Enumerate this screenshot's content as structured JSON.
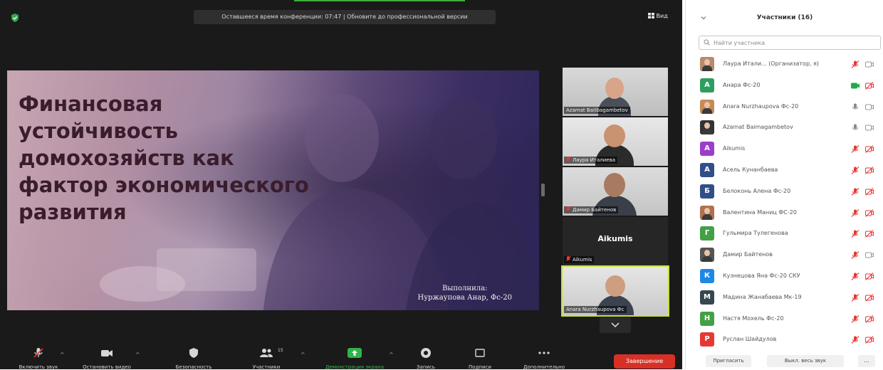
{
  "topbar": {
    "notice": "Оставшееся время конференции: 07:47 | Обновите до профессиональной версии",
    "view_label": "Вид"
  },
  "slide": {
    "title_lines": [
      "Финансовая",
      "устойчивость",
      "домохозяйств как",
      "фактор экономического",
      "развития"
    ],
    "author_lines": [
      "Выполнила:",
      "Нуржаупова Анар, Фс-20"
    ]
  },
  "video_tiles": [
    {
      "name": "Azamat Baitbagambetov",
      "muted": false
    },
    {
      "name": "Лаура Италиева",
      "muted": true
    },
    {
      "name": "Дамир Байтенов",
      "muted": true
    },
    {
      "name": "Aikumis",
      "muted": true,
      "name_card": "Aikumis"
    },
    {
      "name": "Anara Nurzhaupova Фс",
      "muted": false,
      "active": true
    }
  ],
  "toolbar": {
    "items": [
      {
        "label": "Включить звук",
        "icon": "mic-muted-icon"
      },
      {
        "label": "Остановить видео",
        "icon": "video-camera-icon"
      },
      {
        "label": "Безопасность",
        "icon": "shield-icon"
      },
      {
        "label": "Участники",
        "icon": "participants-icon",
        "count": "15"
      },
      {
        "label": "Демонстрация экрана",
        "icon": "share-screen-icon"
      },
      {
        "label": "Запись",
        "icon": "record-icon"
      },
      {
        "label": "Подписи",
        "icon": "captions-icon"
      },
      {
        "label": "Дополнительно",
        "icon": "more-icon"
      }
    ],
    "end_label": "Завершение"
  },
  "panel": {
    "title": "Участники (16)",
    "search_placeholder": "Найти участника",
    "participants": [
      {
        "name": "Лаура Итали... (Организатор, я)",
        "avatar": "photo",
        "color": "#b98a6a",
        "mic": "muted",
        "cam": "off"
      },
      {
        "name": "Анара Фс-20",
        "avatar": "А",
        "color": "#2e9e5e",
        "mic": "active-video",
        "cam": "muted"
      },
      {
        "name": "Anara Nurzhaupova Фс-20",
        "avatar": "photo",
        "color": "#c58a55",
        "mic": "on",
        "cam": "off"
      },
      {
        "name": "Azamat Baimagambetov",
        "avatar": "photo",
        "color": "#333333",
        "mic": "on",
        "cam": "off"
      },
      {
        "name": "Aikumis",
        "avatar": "A",
        "color": "#9b3fc8",
        "mic": "muted",
        "cam": "muted"
      },
      {
        "name": "Асель Кунанбаева",
        "avatar": "А",
        "color": "#2f4f8a",
        "mic": "muted",
        "cam": "muted"
      },
      {
        "name": "Белоконь Алена Фс-20",
        "avatar": "Б",
        "color": "#2f4f8a",
        "mic": "muted",
        "cam": "muted"
      },
      {
        "name": "Валентина Маниц ФС-20",
        "avatar": "photo",
        "color": "#b07050",
        "mic": "muted",
        "cam": "muted"
      },
      {
        "name": "Гульмира Тулегенова",
        "avatar": "Г",
        "color": "#43a047",
        "mic": "muted",
        "cam": "muted"
      },
      {
        "name": "Дамир Байтенов",
        "avatar": "photo",
        "color": "#555555",
        "mic": "muted",
        "cam": "off"
      },
      {
        "name": "Кузнецова Яна Фс-20 СКУ",
        "avatar": "К",
        "color": "#1e88e5",
        "mic": "muted",
        "cam": "muted"
      },
      {
        "name": "Мадина Жанабаева Мк-19",
        "avatar": "М",
        "color": "#37474f",
        "mic": "muted",
        "cam": "muted"
      },
      {
        "name": "Настя Мохель Фс-20",
        "avatar": "Н",
        "color": "#43a047",
        "mic": "muted",
        "cam": "muted"
      },
      {
        "name": "Руслан Шайдулов",
        "avatar": "Р",
        "color": "#e53935",
        "mic": "muted",
        "cam": "muted"
      }
    ],
    "invite_label": "Пригласить",
    "mute_all_label": "Выкл. весь звук",
    "more_label": "..."
  }
}
